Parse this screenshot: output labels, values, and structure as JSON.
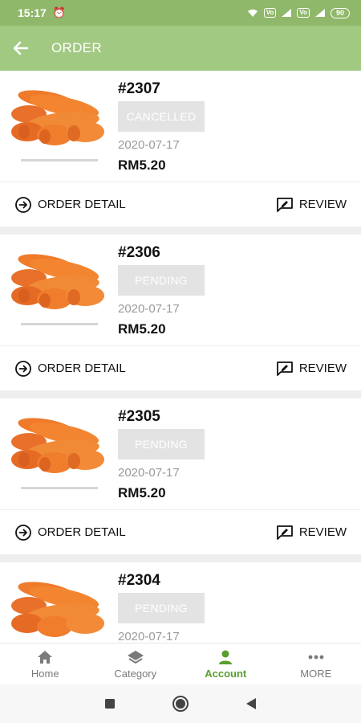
{
  "status_bar": {
    "time": "15:17",
    "badges": [
      "Vo",
      "Vo"
    ],
    "battery": "90"
  },
  "app_bar": {
    "title": "ORDER"
  },
  "orders": [
    {
      "number": "#2307",
      "status": "CANCELLED",
      "date": "2020-07-17",
      "price": "RM5.20",
      "detail_label": "ORDER DETAIL",
      "review_label": "REVIEW"
    },
    {
      "number": "#2306",
      "status": "PENDING",
      "date": "2020-07-17",
      "price": "RM5.20",
      "detail_label": "ORDER DETAIL",
      "review_label": "REVIEW"
    },
    {
      "number": "#2305",
      "status": "PENDING",
      "date": "2020-07-17",
      "price": "RM5.20",
      "detail_label": "ORDER DETAIL",
      "review_label": "REVIEW"
    },
    {
      "number": "#2304",
      "status": "PENDING",
      "date": "2020-07-17",
      "price": "",
      "detail_label": "",
      "review_label": ""
    }
  ],
  "bottom_nav": [
    {
      "label": "Home",
      "icon": "home-icon"
    },
    {
      "label": "Category",
      "icon": "layers-icon"
    },
    {
      "label": "Account",
      "icon": "person-icon",
      "active": true
    },
    {
      "label": "MORE",
      "icon": "more-icon"
    }
  ],
  "colors": {
    "status_bar": "#8fb86a",
    "app_bar": "#a2c982",
    "accent": "#5a9e2f",
    "pill_bg": "#e3e3e3"
  }
}
